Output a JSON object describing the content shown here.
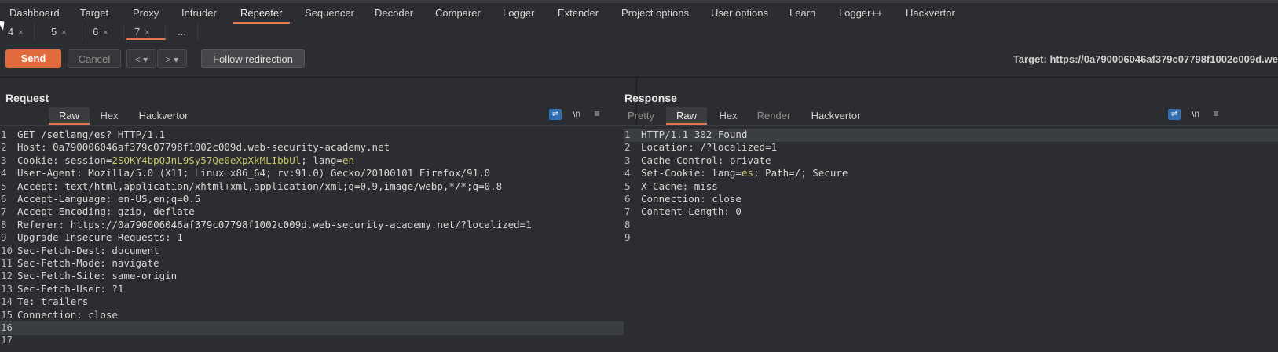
{
  "menu": [
    "Dashboard",
    "Target",
    "Proxy",
    "Intruder",
    "Repeater",
    "Sequencer",
    "Decoder",
    "Comparer",
    "Logger",
    "Extender",
    "Project options",
    "User options",
    "Learn",
    "Logger++",
    "Hackvertor"
  ],
  "repeater_tabs": [
    {
      "label": "4",
      "close": "×"
    },
    {
      "label": "5",
      "close": "×"
    },
    {
      "label": "6",
      "close": "×"
    },
    {
      "label": "7",
      "close": "×"
    },
    {
      "label": "...",
      "close": ""
    }
  ],
  "toolbar": {
    "send": "Send",
    "cancel": "Cancel",
    "back": "<",
    "forward": ">",
    "dropdown": "▾",
    "follow": "Follow redirection",
    "target": "Target: https://0a790006046af379c07798f1002c009d.we"
  },
  "request": {
    "title": "Request",
    "tabs": [
      "Raw",
      "Hex",
      "Hackvertor"
    ],
    "newline_icon": "\\n",
    "menu_icon": "≡",
    "lines": [
      "GET /setlang/es? HTTP/1.1",
      "Host: 0a790006046af379c07798f1002c009d.web-security-academy.net",
      "Cookie: session=2SOKY4bpQJnL9Sy57Qe0eXpXkMLIbbUl; lang=en",
      "User-Agent: Mozilla/5.0 (X11; Linux x86_64; rv:91.0) Gecko/20100101 Firefox/91.0",
      "Accept: text/html,application/xhtml+xml,application/xml;q=0.9,image/webp,*/*;q=0.8",
      "Accept-Language: en-US,en;q=0.5",
      "Accept-Encoding: gzip, deflate",
      "Referer: https://0a790006046af379c07798f1002c009d.web-security-academy.net/?localized=1",
      "Upgrade-Insecure-Requests: 1",
      "Sec-Fetch-Dest: document",
      "Sec-Fetch-Mode: navigate",
      "Sec-Fetch-Site: same-origin",
      "Sec-Fetch-User: ?1",
      "Te: trailers",
      "Connection: close",
      "",
      ""
    ]
  },
  "response": {
    "title": "Response",
    "tabs": [
      "Pretty",
      "Raw",
      "Hex",
      "Render",
      "Hackvertor"
    ],
    "newline_icon": "\\n",
    "menu_icon": "≡",
    "lines": [
      "HTTP/1.1 302 Found",
      "Location: /?localized=1",
      "Cache-Control: private",
      "Set-Cookie: lang=es; Path=/; Secure",
      "X-Cache: miss",
      "Connection: close",
      "Content-Length: 0",
      "",
      ""
    ]
  },
  "colors": {
    "accent": "#e8744d",
    "send": "#e26b3d",
    "highlight": "#c9c46a",
    "blue": "#2f6fb6"
  }
}
